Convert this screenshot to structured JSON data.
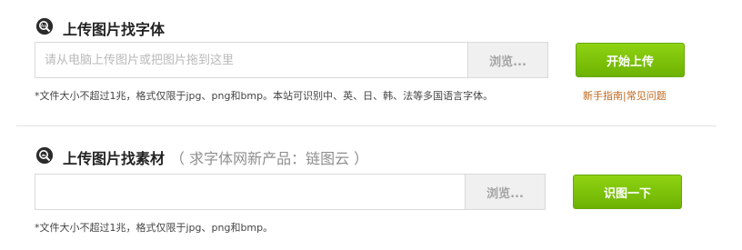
{
  "section_font": {
    "icon": "font-search-icon",
    "title": "上传图片找字体",
    "input": {
      "value": "",
      "placeholder": "请从电脑上传图片或把图片拖到这里"
    },
    "browse_label": "浏览...",
    "upload_label": "开始上传",
    "note": "*文件大小不超过1兆，格式仅限于jpg、png和bmp。本站可识别中、英、日、韩、法等多国语言字体。",
    "link_guide": "新手指南",
    "link_separator": "|",
    "link_faq": "常见问题"
  },
  "section_material": {
    "icon": "image-search-icon",
    "title": "上传图片找素材",
    "subtitle": "（ 求字体网新产品：链图云 ）",
    "input": {
      "value": "",
      "placeholder": ""
    },
    "browse_label": "浏览...",
    "identify_label": "识图一下",
    "note": "*文件大小不超过1兆，格式仅限于jpg、png和bmp。"
  },
  "colors": {
    "accent_green": "#7ec20a",
    "link_orange": "#c0661c",
    "title_dark": "#222222"
  }
}
